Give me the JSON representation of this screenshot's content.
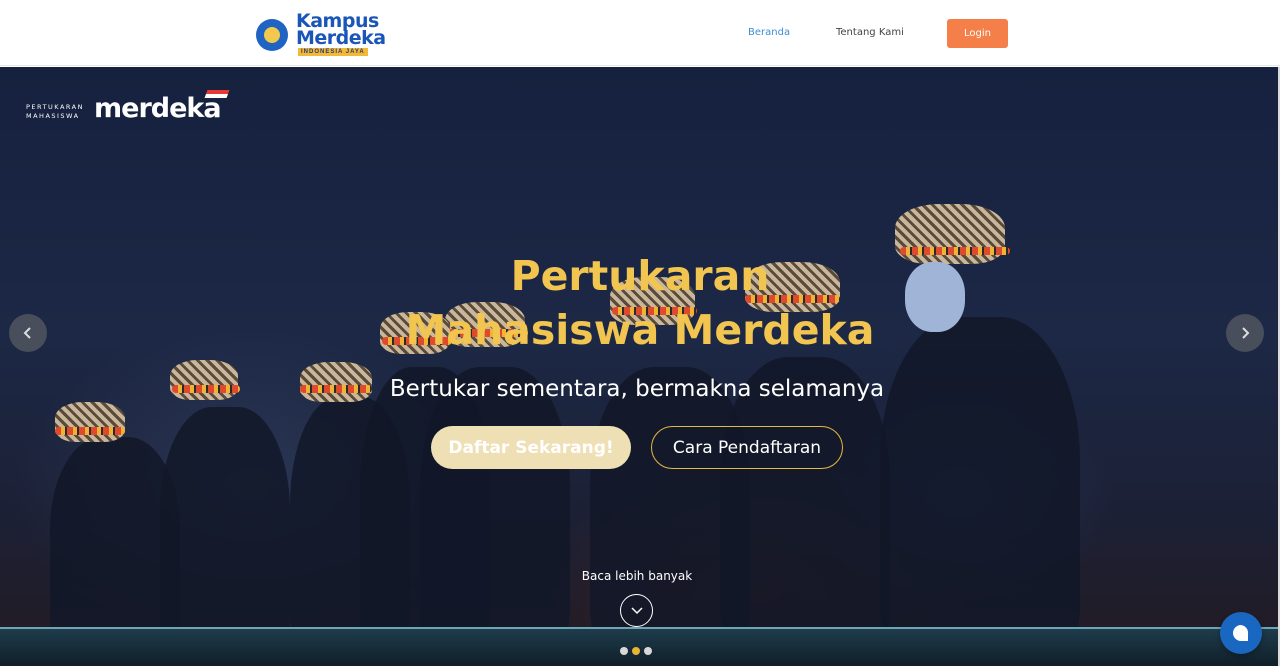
{
  "header": {
    "logo": {
      "line1": "Kampus",
      "line2": "Merdeka",
      "tagline": "INDONESIA JAYA"
    },
    "nav": [
      {
        "label": "Beranda",
        "active": true
      },
      {
        "label": "Tentang Kami",
        "active": false
      }
    ],
    "login_label": "Login"
  },
  "hero": {
    "brand": {
      "small_line1": "PERTUKARAN",
      "small_line2": "MAHASISWA",
      "wordmark": "merdeka"
    },
    "title_line1": "Pertukaran",
    "title_line2": "Mahasiswa Merdeka",
    "subtitle": "Bertukar sementara, bermakna selamanya",
    "primary_button": "Daftar Sekarang!",
    "secondary_button": "Cara Pendaftaran",
    "read_more": "Baca lebih banyak",
    "prev_icon": "chevron-left-icon",
    "next_icon": "chevron-right-icon",
    "slides": {
      "count": 3,
      "active_index": 1
    }
  },
  "colors": {
    "accent_orange": "#f47f49",
    "title_gold": "#f1c54f",
    "nav_active": "#3c8fd6",
    "chat_blue": "#1a67c2"
  },
  "chat_icon": "chat-bubble-icon"
}
